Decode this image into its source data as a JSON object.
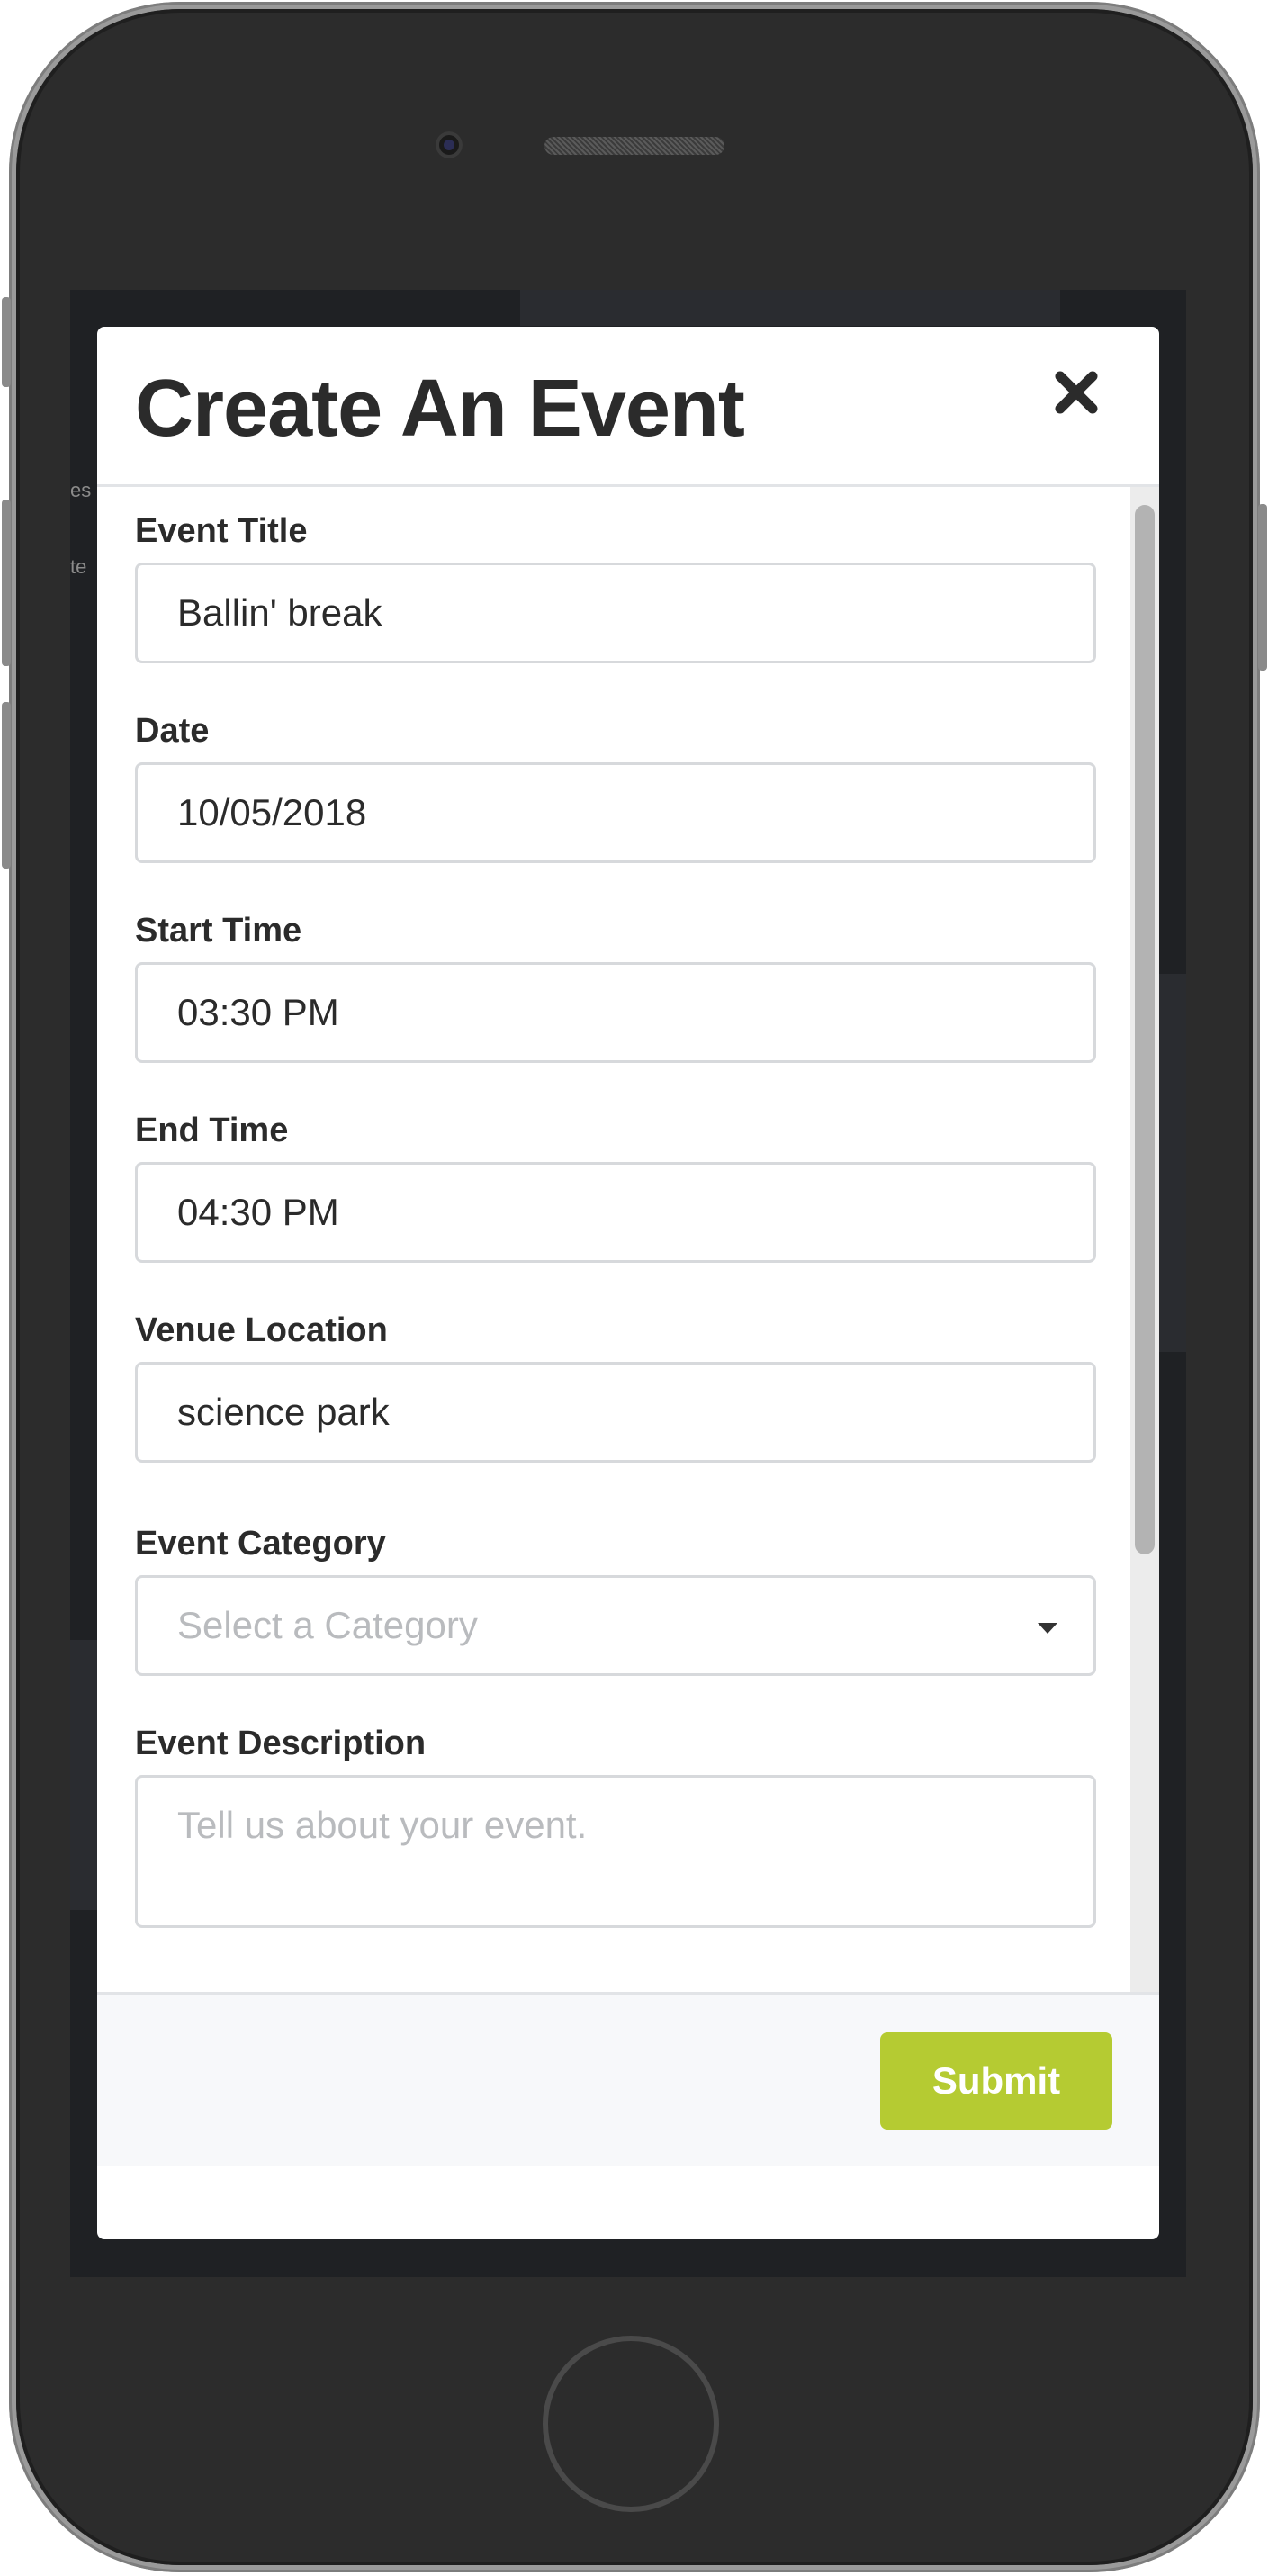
{
  "modal": {
    "title": "Create An Event",
    "close_icon": "close-icon"
  },
  "form": {
    "fields": [
      {
        "label": "Event Title",
        "value": "Ballin' break"
      },
      {
        "label": "Date",
        "value": "10/05/2018"
      },
      {
        "label": "Start Time",
        "value": "03:30 PM"
      },
      {
        "label": "End Time",
        "value": "04:30 PM"
      },
      {
        "label": "Venue Location",
        "value": "science park"
      },
      {
        "label": "Event Category",
        "placeholder": "Select a Category"
      },
      {
        "label": "Event Description",
        "placeholder": "Tell us about your event."
      }
    ]
  },
  "footer": {
    "submit_label": "Submit"
  },
  "colors": {
    "submit_button": "#b5cb32",
    "title_text": "#2b2b2b",
    "placeholder_text": "#b9bbbe"
  }
}
